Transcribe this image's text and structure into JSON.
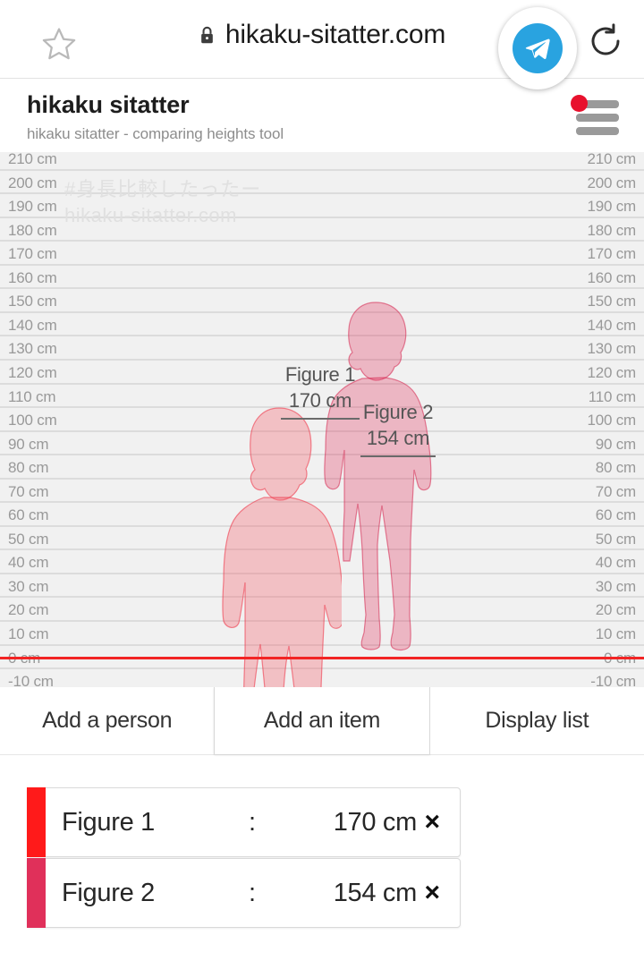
{
  "browser": {
    "url": "hikaku-sitatter.com",
    "bookmark_icon": "star-outline-icon",
    "secure_icon": "lock-icon",
    "reload_icon": "reload-icon",
    "share_icon": "telegram-icon"
  },
  "site": {
    "title": "hikaku sitatter",
    "subtitle": "hikaku sitatter - comparing heights tool",
    "menu_icon": "hamburger-menu-icon",
    "menu_has_notification": true
  },
  "chart_data": {
    "type": "bar",
    "title": "",
    "xlabel": "",
    "ylabel": "cm",
    "ylim": [
      -10,
      210
    ],
    "grid": true,
    "tick_step": 10,
    "tick_labels": [
      "210 cm",
      "200 cm",
      "190 cm",
      "180 cm",
      "170 cm",
      "160 cm",
      "150 cm",
      "140 cm",
      "130 cm",
      "120 cm",
      "110 cm",
      "100 cm",
      "90 cm",
      "80 cm",
      "70 cm",
      "60 cm",
      "50 cm",
      "40 cm",
      "30 cm",
      "20 cm",
      "10 cm",
      "0 cm",
      "-10 cm"
    ],
    "categories": [
      "Figure 1",
      "Figure 2"
    ],
    "values": [
      170,
      154
    ],
    "unit": "cm",
    "baseline_value": 0,
    "baseline_color": "#f22424",
    "series_colors": [
      "#FF1A1A",
      "#E0305A"
    ],
    "annotations": [
      {
        "name": "Figure 1",
        "height": "170 cm"
      },
      {
        "name": "Figure 2",
        "height": "154 cm"
      }
    ],
    "watermark_line1": "#身長比較したったー",
    "watermark_line2": "hikaku-sitatter.com"
  },
  "actions": {
    "add_person": "Add a person",
    "add_item": "Add an item",
    "display_list": "Display list"
  },
  "list": {
    "separator": ":",
    "remove_label": "×",
    "items": [
      {
        "name": "Figure 1",
        "value": "170 cm",
        "color": "#FF1A1A"
      },
      {
        "name": "Figure 2",
        "value": "154 cm",
        "color": "#E0305A"
      }
    ]
  }
}
